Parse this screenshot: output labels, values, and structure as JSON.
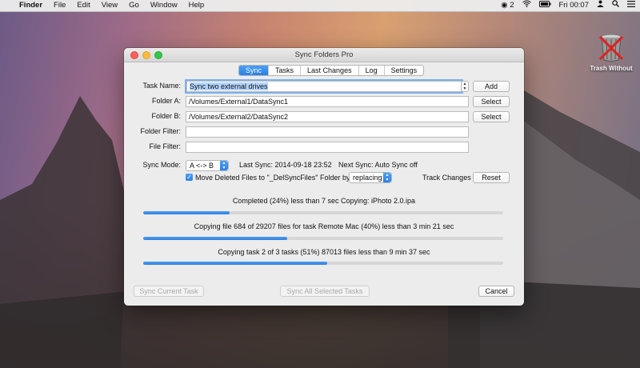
{
  "menubar": {
    "app_name": "Finder",
    "menus": [
      "File",
      "Edit",
      "View",
      "Go",
      "Window",
      "Help"
    ],
    "status_count": "2",
    "clock": "Fri 00:07"
  },
  "desktop": {
    "trash_label": "Trash Without"
  },
  "window": {
    "title": "Sync Folders Pro",
    "tabs": [
      "Sync",
      "Tasks",
      "Last Changes",
      "Log",
      "Settings"
    ],
    "active_tab": "Sync",
    "task_name_label": "Task Name:",
    "task_name_value": "Sync two external drives",
    "add_button": "Add",
    "folder_a_label": "Folder A:",
    "folder_a_value": "/Volumes/External1/DataSync1",
    "folder_b_label": "Folder B:",
    "folder_b_value": "/Volumes/External2/DataSync2",
    "select_button": "Select",
    "folder_filter_label": "Folder Filter:",
    "file_filter_label": "File Filter:",
    "sync_mode_label": "Sync Mode:",
    "sync_mode_value": "A <-> B",
    "last_sync": "Last Sync: 2014-09-18 23:52",
    "next_sync": "Next Sync: Auto Sync off",
    "move_deleted_label": "Move Deleted Files to \"_DelSyncFiles\" Folder by:",
    "move_deleted_checked": true,
    "replacing_value": "replacing",
    "track_changes_label": "Track Changes",
    "reset_button": "Reset",
    "progress": [
      {
        "text": "Completed (24%) less than 7 sec Copying: iPhoto 2.0.ipa",
        "fraction": 0.24
      },
      {
        "text": "Copying file 684 of 29207 files for task Remote Mac (40%) less than 3 min 21 sec",
        "fraction": 0.4
      },
      {
        "text": "Copying task 2 of 3 tasks (51%) 87013 files less than 9 min 37 sec",
        "fraction": 0.51
      }
    ],
    "sync_current_button": "Sync Current Task",
    "sync_all_button": "Sync All Selected Tasks",
    "cancel_button": "Cancel"
  }
}
